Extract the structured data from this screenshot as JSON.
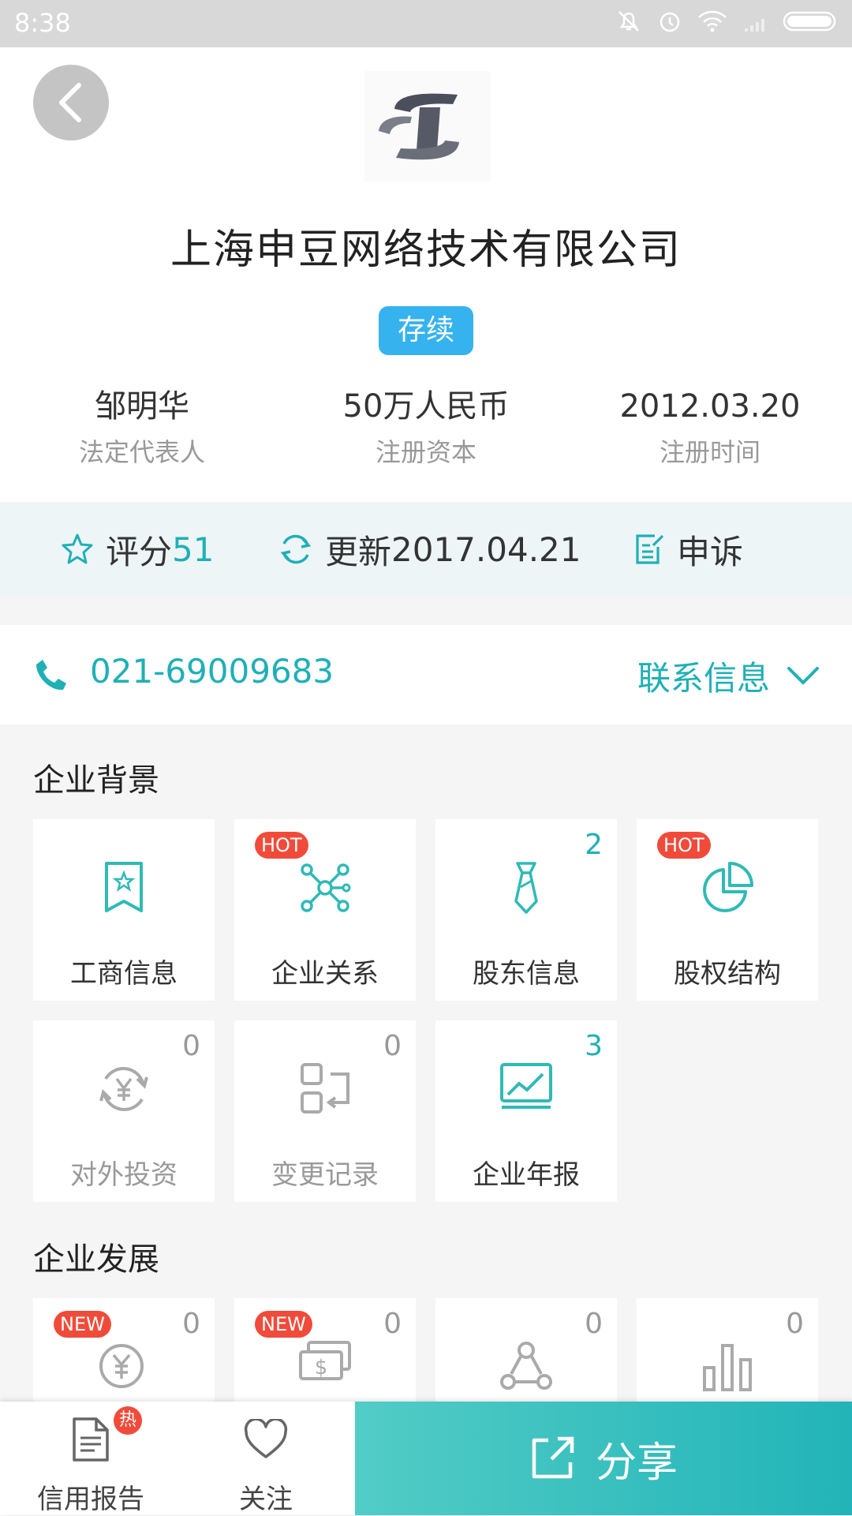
{
  "status_bar": {
    "time": "8:38"
  },
  "company": {
    "name": "上海申豆网络技术有限公司",
    "status": "存续",
    "legal_rep": "邹明华",
    "legal_rep_label": "法定代表人",
    "capital": "50万人民币",
    "capital_label": "注册资本",
    "reg_date": "2012.03.20",
    "reg_date_label": "注册时间"
  },
  "meta": {
    "score_label": "评分",
    "score_value": "51",
    "update_label": "更新",
    "update_value": "2017.04.21",
    "appeal_label": "申诉"
  },
  "contact": {
    "phone": "021-69009683",
    "link_label": "联系信息"
  },
  "background_section": {
    "title": "企业背景",
    "tiles": [
      {
        "label": "工商信息",
        "icon": "bookmark-star-icon",
        "badge": "",
        "count": ""
      },
      {
        "label": "企业关系",
        "icon": "network-icon",
        "badge": "HOT",
        "count": ""
      },
      {
        "label": "股东信息",
        "icon": "tie-icon",
        "badge": "",
        "count": "2"
      },
      {
        "label": "股权结构",
        "icon": "pie-chart-icon",
        "badge": "HOT",
        "count": ""
      },
      {
        "label": "对外投资",
        "icon": "yen-cycle-icon",
        "badge": "",
        "count": "0"
      },
      {
        "label": "变更记录",
        "icon": "change-record-icon",
        "badge": "",
        "count": "0"
      },
      {
        "label": "企业年报",
        "icon": "line-chart-icon",
        "badge": "",
        "count": "3"
      }
    ]
  },
  "development_section": {
    "title": "企业发展",
    "tiles": [
      {
        "icon": "yen-growth-icon",
        "badge": "NEW",
        "count": "0"
      },
      {
        "icon": "dollar-bill-icon",
        "badge": "NEW",
        "count": "0"
      },
      {
        "icon": "group-icon",
        "badge": "",
        "count": "0"
      },
      {
        "icon": "bar-chart-icon",
        "badge": "",
        "count": "0"
      }
    ]
  },
  "bottom_bar": {
    "credit_report": "信用报告",
    "credit_badge": "热",
    "follow": "关注",
    "share": "分享"
  },
  "colors": {
    "accent": "#1fb0b6",
    "status_badge": "#36b3ef",
    "hot_badge": "#f04b3a"
  }
}
